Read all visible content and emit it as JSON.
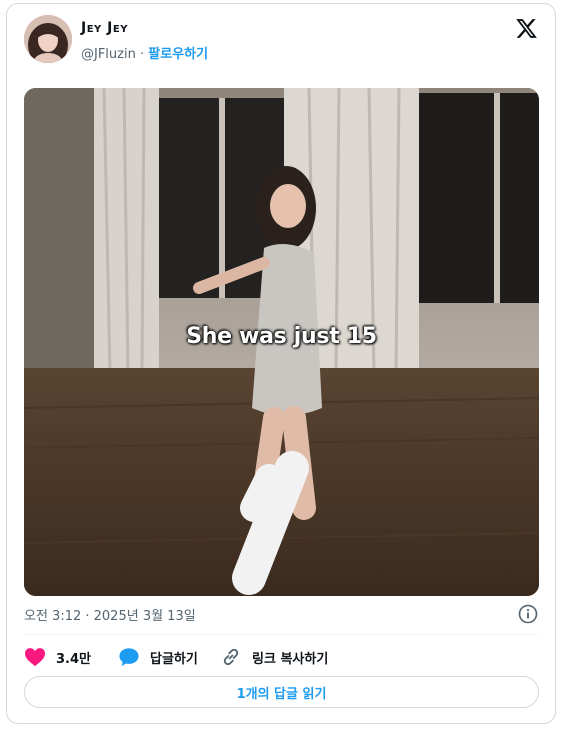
{
  "author": {
    "display_name": "Jey Jey",
    "handle": "@JFluzin",
    "separator": "·",
    "follow_label": "팔로우하기"
  },
  "media": {
    "caption": "She was just 15"
  },
  "timestamp": "오전 3:12 · 2025년 3월 13일",
  "actions": {
    "likes": "3.4만",
    "reply_label": "답글하기",
    "copy_link_label": "링크 복사하기"
  },
  "read_replies_label": "1개의 답글 읽기",
  "colors": {
    "accent": "#1d9bf0",
    "like": "#f91880",
    "text": "#0f1419",
    "muted": "#536471"
  },
  "icons": [
    "x-logo-icon",
    "info-icon",
    "heart-icon",
    "reply-bubble-icon",
    "link-icon"
  ]
}
